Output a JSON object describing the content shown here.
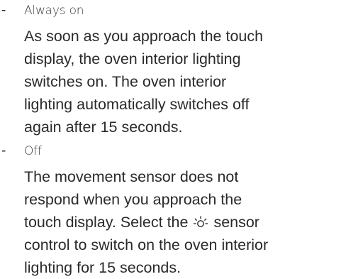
{
  "items": [
    {
      "bullet": "-",
      "option": "Always on",
      "lines": [
        "As soon as you approach the touch",
        "display, the oven interior lighting",
        "switches on. The oven interior",
        "lighting automatically switches off",
        "again after 15 seconds."
      ]
    },
    {
      "bullet": "-",
      "option": "Off",
      "lines": [
        "The movement sensor does not",
        "respond when you approach the",
        "touch display. Select the",
        "sensor",
        "control to switch on the oven interior",
        "lighting for 15 seconds."
      ],
      "inline_icon": "light-bulb-sun-icon"
    }
  ]
}
